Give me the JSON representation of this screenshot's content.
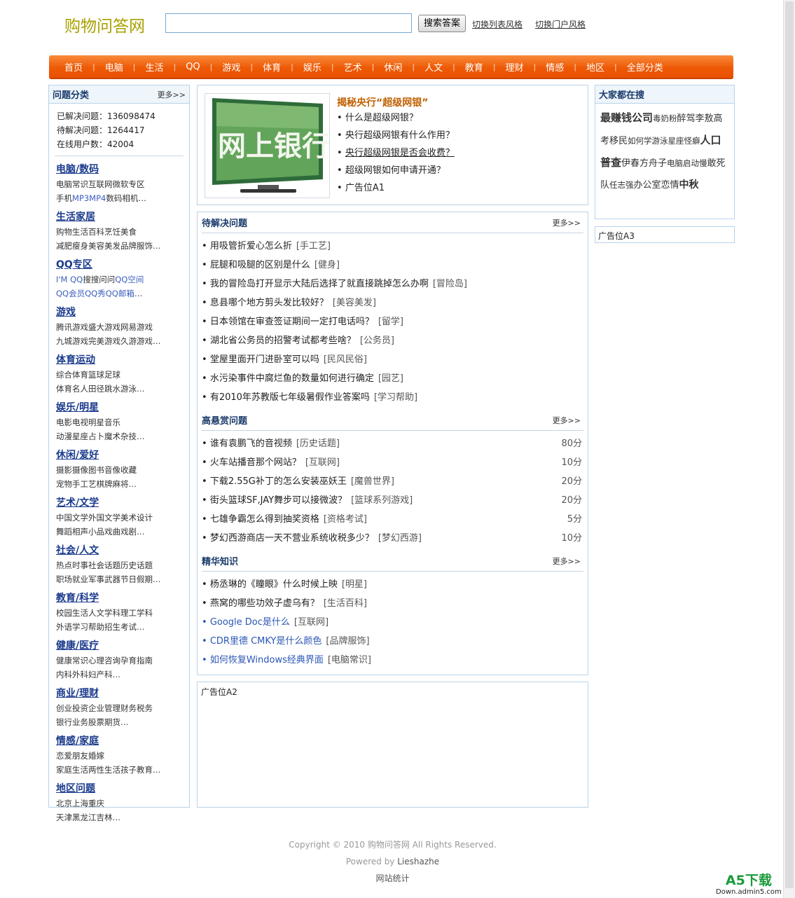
{
  "header": {
    "logo": "购物问答网",
    "search_placeholder": "",
    "search_button": "搜索答案",
    "switch_list": "切换列表风格",
    "switch_portal": "切换门户风格"
  },
  "nav": [
    "首页",
    "电脑",
    "生活",
    "QQ",
    "游戏",
    "体育",
    "娱乐",
    "艺术",
    "休闲",
    "人文",
    "教育",
    "理财",
    "情感",
    "地区",
    "全部分类"
  ],
  "left": {
    "title": "问题分类",
    "more": "更多>>",
    "stats": [
      {
        "label": "已解决问题：",
        "value": "136098474"
      },
      {
        "label": "待解决问题：",
        "value": "1264417"
      },
      {
        "label": "在线用户数：",
        "value": "42004"
      }
    ],
    "categories": [
      {
        "title": "电脑/数码",
        "line1": [
          "电脑常识",
          "互联网",
          "微软专区"
        ],
        "line2": [
          "手机",
          "MP3MP4",
          "数码相机",
          "…"
        ]
      },
      {
        "title": "生活家居",
        "line1": [
          "购物",
          "生活百科",
          "烹饪美食"
        ],
        "line2": [
          "减肥瘦身",
          "美容美发",
          "品牌服饰",
          "…"
        ]
      },
      {
        "title": "QQ专区",
        "line1": [
          "I'M QQ",
          "搜搜问问",
          "QQ空间"
        ],
        "line2": [
          "QQ会员",
          "QQ秀",
          "QQ邮箱",
          "…"
        ]
      },
      {
        "title": "游戏",
        "line1": [
          "腾讯游戏",
          "盛大游戏",
          "网易游戏"
        ],
        "line2": [
          "九城游戏",
          "完美游戏",
          "久游游戏",
          "…"
        ]
      },
      {
        "title": "体育运动",
        "line1": [
          "综合体育",
          "篮球",
          "足球"
        ],
        "line2": [
          "体育名人",
          "田径",
          "跳水游泳",
          "…"
        ]
      },
      {
        "title": "娱乐/明星",
        "line1": [
          "电影电视",
          "明星",
          "音乐"
        ],
        "line2": [
          "动漫",
          "星座占卜",
          "魔术杂技",
          "…"
        ]
      },
      {
        "title": "休闲/爱好",
        "line1": [
          "摄影摄像",
          "图书音像",
          "收藏"
        ],
        "line2": [
          "宠物",
          "手工艺",
          "棋牌麻将",
          "…"
        ]
      },
      {
        "title": "艺术/文学",
        "line1": [
          "中国文学",
          "外国文学",
          "美术设计"
        ],
        "line2": [
          "舞蹈",
          "相声小品",
          "戏曲戏剧",
          "…"
        ]
      },
      {
        "title": "社会/人文",
        "line1": [
          "热点时事",
          "社会话题",
          "历史话题"
        ],
        "line2": [
          "职场就业",
          "军事武器",
          "节日假期",
          "…"
        ]
      },
      {
        "title": "教育/科学",
        "line1": [
          "校园生活",
          "人文学科",
          "理工学科"
        ],
        "line2": [
          "外语",
          "学习帮助",
          "招生考试",
          "…"
        ]
      },
      {
        "title": "健康/医疗",
        "line1": [
          "健康常识",
          "心理咨询",
          "孕育指南"
        ],
        "line2": [
          "内科",
          "外科",
          "妇产科",
          "…"
        ]
      },
      {
        "title": "商业/理财",
        "line1": [
          "创业投资",
          "企业管理",
          "财务税务"
        ],
        "line2": [
          "银行业务",
          "股票",
          "期货",
          "…"
        ]
      },
      {
        "title": "情感/家庭",
        "line1": [
          "恋爱",
          "朋友",
          "婚嫁"
        ],
        "line2": [
          "家庭生活",
          "两性生活",
          "孩子教育",
          "…"
        ]
      },
      {
        "title": "地区问题",
        "line1": [
          "北京",
          "上海",
          "重庆"
        ],
        "line2": [
          "天津",
          "黑龙江",
          "吉林",
          "…"
        ]
      }
    ]
  },
  "feature": {
    "image_text": "网上银行",
    "title": "揭秘央行“超级网银”",
    "items": [
      "什么是超级网银？",
      "央行超级网银有什么作用？",
      "央行超级网银是否会收费？",
      "超级网银如何申请开通？",
      "广告位A1"
    ]
  },
  "pending": {
    "title": "待解决问题",
    "more": "更多>>",
    "items": [
      {
        "q": "用吸管折爱心怎么折",
        "tag": "[手工艺]"
      },
      {
        "q": "屁腿和吸腿的区别是什么",
        "tag": "[健身]"
      },
      {
        "q": "我的冒险岛打开显示大陆后选择了就直接跳掉怎么办啊",
        "tag": "[冒险岛]"
      },
      {
        "q": "息县哪个地方剪头发比较好？",
        "tag": "[美容美发]"
      },
      {
        "q": "日本领馆在审查签证期间一定打电话吗？",
        "tag": "[留学]"
      },
      {
        "q": "湖北省公务员的招警考试都考些啥？",
        "tag": "[公务员]"
      },
      {
        "q": "堂屋里面开门进卧室可以吗",
        "tag": "[民风民俗]"
      },
      {
        "q": "水污染事件中腐烂鱼的数量如何进行确定",
        "tag": "[园艺]"
      },
      {
        "q": "有2010年苏教版七年级暑假作业答案吗",
        "tag": "[学习帮助]"
      }
    ]
  },
  "reward": {
    "title": "高悬赏问题",
    "more": "更多>>",
    "items": [
      {
        "q": "谁有袁鹏飞的音视频",
        "tag": "[历史话题]",
        "pts": "80分"
      },
      {
        "q": "火车站播音那个网站？",
        "tag": "[互联网]",
        "pts": "10分"
      },
      {
        "q": "下载2.55G补丁的怎么安装巫妖王",
        "tag": "[魔兽世界]",
        "pts": "20分"
      },
      {
        "q": "街头篮球SF,JAY舞步可以接微波？",
        "tag": "[篮球系列游戏]",
        "pts": "20分"
      },
      {
        "q": "七雄争霸怎么得到抽奖资格",
        "tag": "[资格考试]",
        "pts": "5分"
      },
      {
        "q": "梦幻西游商店一天不营业系统收税多少？",
        "tag": "[梦幻西游]",
        "pts": "10分"
      }
    ]
  },
  "essence": {
    "title": "精华知识",
    "more": "更多>>",
    "items": [
      {
        "q": "杨丞琳的《瞳眼》什么时候上映",
        "tag": "[明星]"
      },
      {
        "q": "燕窝的哪些功效子虚乌有？",
        "tag": "[生活百科]"
      },
      {
        "q": "Google Doc是什么",
        "tag": "[互联网]"
      },
      {
        "q": "CDR里德  CMKY是什么颜色",
        "tag": "[品牌服饰]"
      },
      {
        "q": "如何恢复Windows经典界面",
        "tag": "[电脑常识]"
      }
    ]
  },
  "ad2": "广告位A2",
  "right": {
    "title": "大家都在搜",
    "tags": [
      {
        "t": "最赚钱公司",
        "s": "l"
      },
      {
        "t": "毒奶粉",
        "s": "xs"
      },
      {
        "t": "醉驾",
        "s": "s"
      },
      {
        "t": "李敖",
        "s": "s"
      },
      {
        "t": "高考移民",
        "s": "s"
      },
      {
        "t": "如何学游泳",
        "s": "xs"
      },
      {
        "t": "星座怪癖",
        "s": "xs"
      },
      {
        "t": "人口普查",
        "s": "l"
      },
      {
        "t": "伊春",
        "s": "s"
      },
      {
        "t": "方舟子",
        "s": "s"
      },
      {
        "t": "电脑启动慢",
        "s": "xs"
      },
      {
        "t": "敢死队",
        "s": "s"
      },
      {
        "t": "任志强",
        "s": "xs"
      },
      {
        "t": "办公室恋情",
        "s": "s"
      },
      {
        "t": "中秋",
        "s": "m"
      }
    ]
  },
  "ad3": "广告位A3",
  "footer": {
    "copyright": "Copyright © 2010 购物问答网 All Rights Reserved.",
    "powered_prefix": "Powered by ",
    "powered_name": "Lieshazhe",
    "stats": "网站统计"
  },
  "watermark": {
    "big": "A5下载",
    "small": "Down.admin5.com"
  }
}
